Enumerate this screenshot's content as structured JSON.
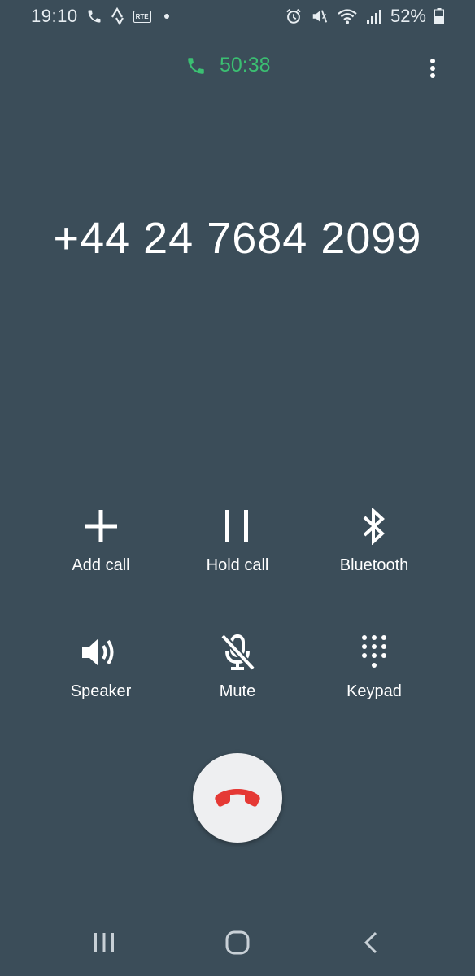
{
  "status_bar": {
    "time": "19:10",
    "left_icons": [
      "phone-icon",
      "strava-icon",
      "rte-icon",
      "dot-icon"
    ],
    "rte_label": "RTE",
    "right_icons": [
      "alarm-icon",
      "mute-icon",
      "wifi-icon",
      "signal-icon",
      "battery-icon"
    ],
    "battery": "52%"
  },
  "call": {
    "timer": "50:38",
    "timer_color": "#3bbf72",
    "number": "+44 24 7684 2099"
  },
  "controls": [
    {
      "label": "Add call",
      "icon": "plus-icon"
    },
    {
      "label": "Hold call",
      "icon": "pause-icon"
    },
    {
      "label": "Bluetooth",
      "icon": "bluetooth-icon"
    },
    {
      "label": "Speaker",
      "icon": "speaker-icon"
    },
    {
      "label": "Mute",
      "icon": "mic-off-icon"
    },
    {
      "label": "Keypad",
      "icon": "keypad-icon"
    }
  ],
  "end_call": {
    "icon": "hang-up-icon",
    "color": "#e53935"
  },
  "nav": {
    "buttons": [
      "recents-icon",
      "home-icon",
      "back-icon"
    ]
  },
  "colors": {
    "background": "#3b4d59",
    "end_button_bg": "#eeeff1"
  }
}
